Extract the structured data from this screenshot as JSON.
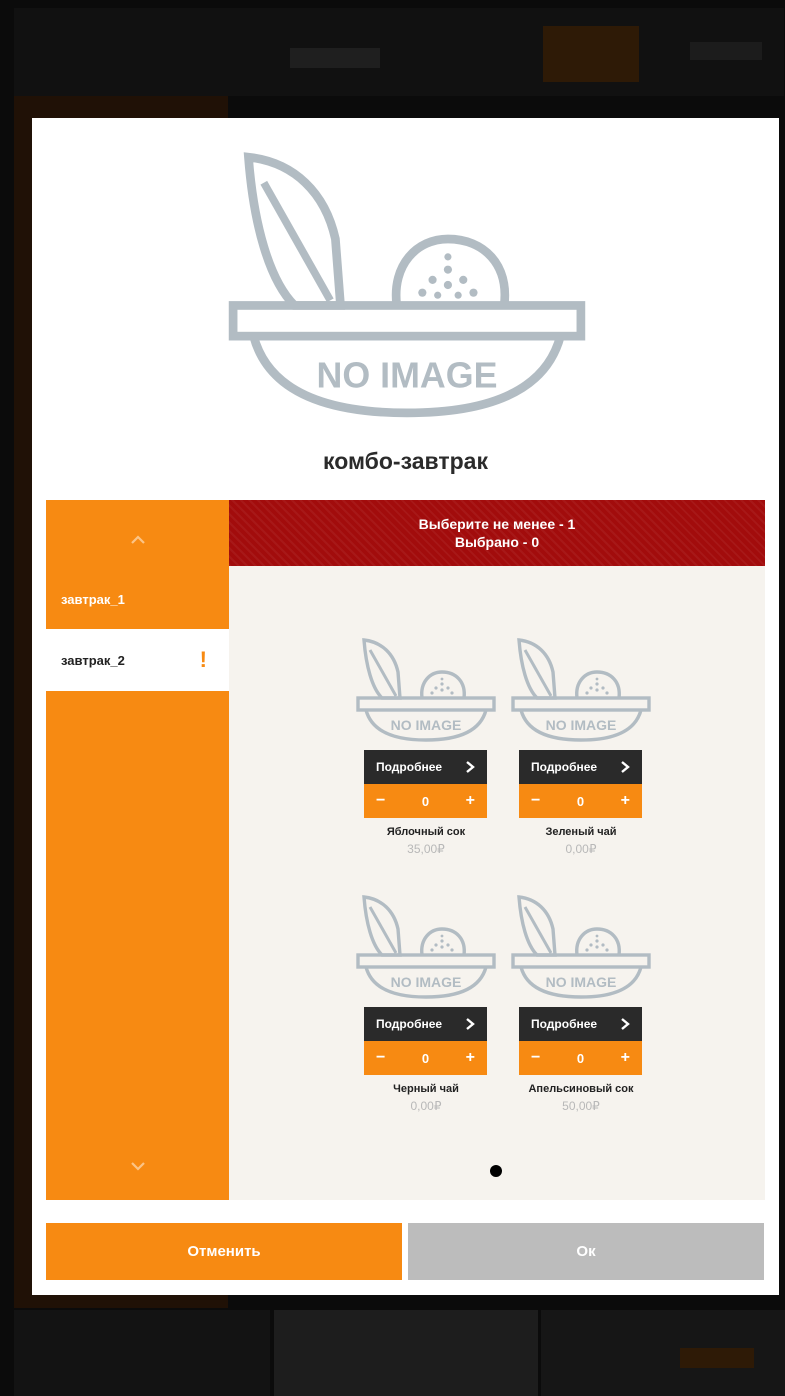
{
  "background_app": {
    "accent_color": "#f78a12"
  },
  "modal": {
    "image_placeholder_text": "NO IMAGE",
    "title": "комбо-завтрак",
    "categories": [
      {
        "label": "завтрак_1",
        "state": "active"
      },
      {
        "label": "завтрак_2",
        "state": "selected",
        "warning": "!"
      }
    ],
    "banner": {
      "line1": "Выберите не менее - 1",
      "line2": "Выбрано - 0",
      "color": "#a20c0c"
    },
    "products": [
      {
        "details_label": "Подробнее",
        "quantity": "0",
        "name": "Яблочный сок",
        "price": "35,00₽",
        "image_text": "NO IMAGE"
      },
      {
        "details_label": "Подробнее",
        "quantity": "0",
        "name": "Зеленый чай",
        "price": "0,00₽",
        "image_text": "NO IMAGE"
      },
      {
        "details_label": "Подробнее",
        "quantity": "0",
        "name": "Черный чай",
        "price": "0,00₽",
        "image_text": "NO IMAGE"
      },
      {
        "details_label": "Подробнее",
        "quantity": "0",
        "name": "Апельсиновый сок",
        "price": "50,00₽",
        "image_text": "NO IMAGE"
      }
    ],
    "stepper": {
      "minus": "−",
      "plus": "+"
    },
    "buttons": {
      "cancel": "Отменить",
      "ok": "Ок"
    },
    "colors": {
      "accent": "#f78a12",
      "disabled": "#bcbcbc",
      "placeholder_gray": "#b2bcc3"
    }
  }
}
